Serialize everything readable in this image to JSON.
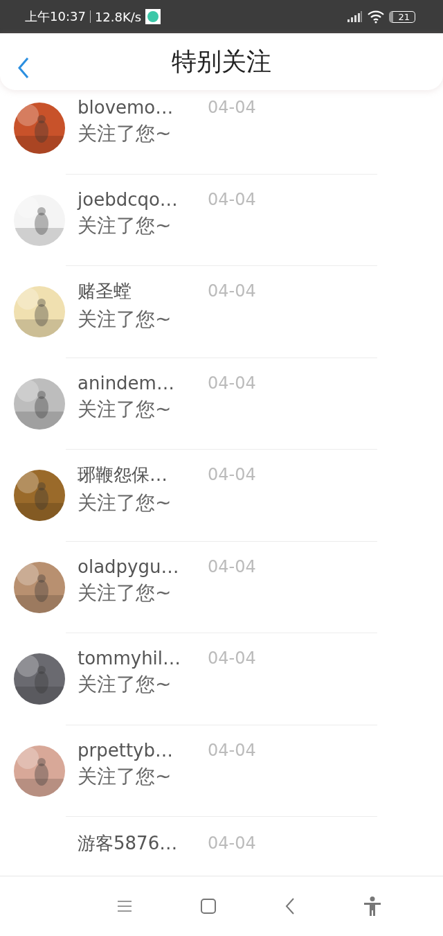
{
  "status_bar": {
    "time": "上午10:37",
    "speed": "12.8K/s",
    "battery": "21"
  },
  "header": {
    "title": "特别关注"
  },
  "notifications": [
    {
      "name": "blovemo…",
      "date": "04-04",
      "message": "关注了您~"
    },
    {
      "name": "joebdcqo…",
      "date": "04-04",
      "message": "关注了您~"
    },
    {
      "name": "赌圣螳",
      "date": "04-04",
      "message": "关注了您~"
    },
    {
      "name": "anindem…",
      "date": "04-04",
      "message": "关注了您~"
    },
    {
      "name": "琊鞭怨保…",
      "date": "04-04",
      "message": "关注了您~"
    },
    {
      "name": "oladpygu…",
      "date": "04-04",
      "message": "关注了您~"
    },
    {
      "name": "tommyhil…",
      "date": "04-04",
      "message": "关注了您~"
    },
    {
      "name": "prpettyb…",
      "date": "04-04",
      "message": "关注了您~"
    },
    {
      "name": "游客5876…",
      "date": "04-04"
    }
  ]
}
